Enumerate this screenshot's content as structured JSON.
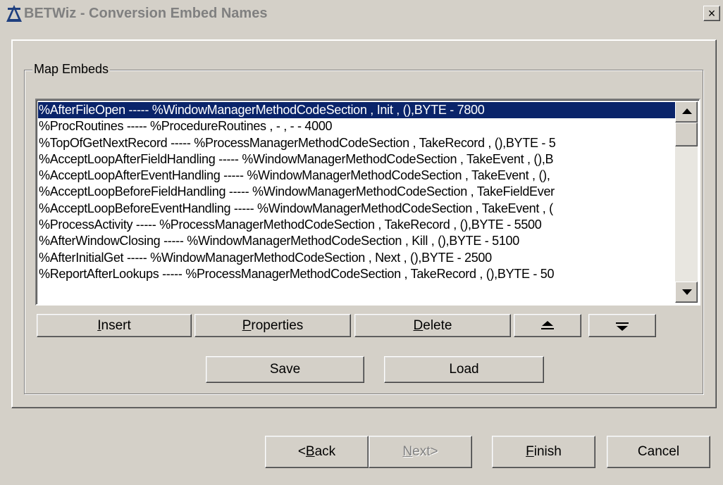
{
  "window": {
    "title": "BETWiz - Conversion Embed Names",
    "close_label": "×"
  },
  "group": {
    "label": "Map Embeds"
  },
  "list": {
    "items": [
      "%AfterFileOpen ----- %WindowManagerMethodCodeSection , Init , (),BYTE - 7800",
      "%ProcRoutines ----- %ProcedureRoutines , - , - - 4000",
      "%TopOfGetNextRecord ----- %ProcessManagerMethodCodeSection , TakeRecord , (),BYTE - 5",
      "%AcceptLoopAfterFieldHandling ----- %WindowManagerMethodCodeSection , TakeEvent , (),B",
      "%AcceptLoopAfterEventHandling ----- %WindowManagerMethodCodeSection , TakeEvent , (),",
      "%AcceptLoopBeforeFieldHandling ----- %WindowManagerMethodCodeSection , TakeFieldEver",
      "%AcceptLoopBeforeEventHandling ----- %WindowManagerMethodCodeSection , TakeEvent , (",
      "%ProcessActivity ----- %ProcessManagerMethodCodeSection , TakeRecord , (),BYTE - 5500",
      "%AfterWindowClosing ----- %WindowManagerMethodCodeSection , Kill , (),BYTE - 5100",
      "%AfterInitialGet ----- %WindowManagerMethodCodeSection , Next , (),BYTE - 2500",
      "%ReportAfterLookups ----- %ProcessManagerMethodCodeSection , TakeRecord , (),BYTE - 50"
    ],
    "selected_index": 0
  },
  "buttons": {
    "insert": {
      "pre": "",
      "key": "I",
      "post": "nsert"
    },
    "properties": {
      "pre": "",
      "key": "P",
      "post": "roperties"
    },
    "delete": {
      "pre": "",
      "key": "D",
      "post": "elete"
    },
    "save": "Save",
    "load": "Load",
    "back": {
      "pre": "<",
      "key": "B",
      "post": "ack"
    },
    "next": {
      "pre": "",
      "key": "N",
      "post": "ext>"
    },
    "finish": {
      "pre": "",
      "key": "F",
      "post": "inish"
    },
    "cancel": "Cancel"
  },
  "icons": {
    "app": "betwiz-app-icon",
    "move_up": "move-up-icon",
    "move_down": "move-down-icon"
  },
  "colors": {
    "selection": "#0a246a",
    "face": "#d4d0c8"
  }
}
